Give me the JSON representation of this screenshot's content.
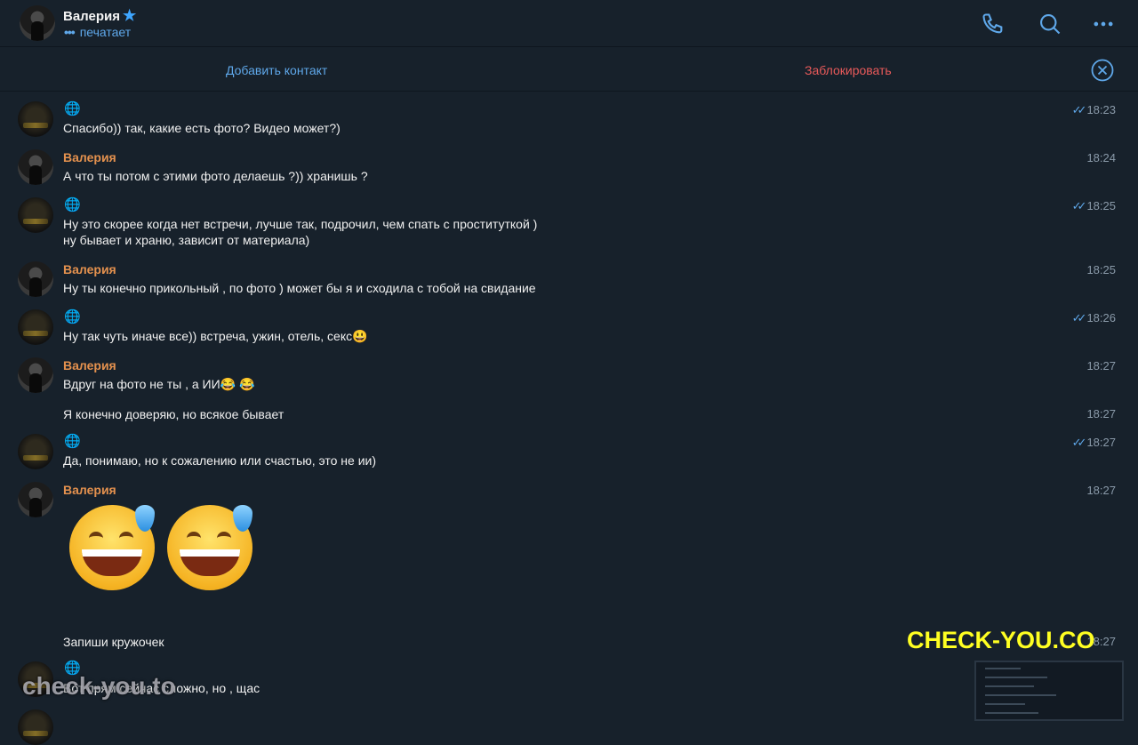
{
  "header": {
    "name": "Валерия",
    "status": "печатает",
    "icons": [
      "phone-icon",
      "search-icon",
      "more-icon"
    ]
  },
  "actions": {
    "add_contact": "Добавить контакт",
    "block": "Заблокировать"
  },
  "messages": [
    {
      "sender": "",
      "text": "Спасибо)) так, какие есть фото? Видео может?)",
      "time": "18:23",
      "read": true
    },
    {
      "sender": "Валерия",
      "text": "А что ты потом с этими фото делаешь ?)) хранишь ?",
      "time": "18:24",
      "read": false
    },
    {
      "sender": "",
      "text": "Ну это скорее когда нет встречи, лучше так, подрочил, чем спать с проституткой )\nну бывает и храню, зависит от материала)",
      "time": "18:25",
      "read": true
    },
    {
      "sender": "Валерия",
      "text": "Ну ты конечно прикольный , по фото ) может бы я и сходила с тобой на свидание",
      "time": "18:25",
      "read": false
    },
    {
      "sender": "",
      "text": "Ну так чуть иначе все)) встреча, ужин, отель, секс😃",
      "time": "18:26",
      "read": true
    },
    {
      "sender": "Валерия",
      "text": "Вдруг на фото не ты , а ИИ😂 😂",
      "time": "18:27",
      "read": false
    },
    {
      "sender": "",
      "text": "Я конечно доверяю, но всякое бывает",
      "time": "18:27",
      "read": false
    },
    {
      "sender": "",
      "text": "Да, понимаю, но к сожалению или счастью, это не ии)",
      "time": "18:27",
      "read": true
    },
    {
      "sender": "Валерия",
      "text": "",
      "time": "18:27",
      "read": false
    },
    {
      "sender": "",
      "text": "Запиши кружочек",
      "time": "18:27",
      "read": false
    },
    {
      "sender": "",
      "text": "Вот прям сейчас сложно, но , щас",
      "time": "",
      "read": false
    }
  ],
  "watermarks": {
    "right": "CHECK-YOU.CO",
    "left": "check-you.to"
  },
  "colors": {
    "background": "#17212b",
    "accent": "#5fa8ea",
    "sender": "#e4914e",
    "danger": "#e95a5a"
  }
}
